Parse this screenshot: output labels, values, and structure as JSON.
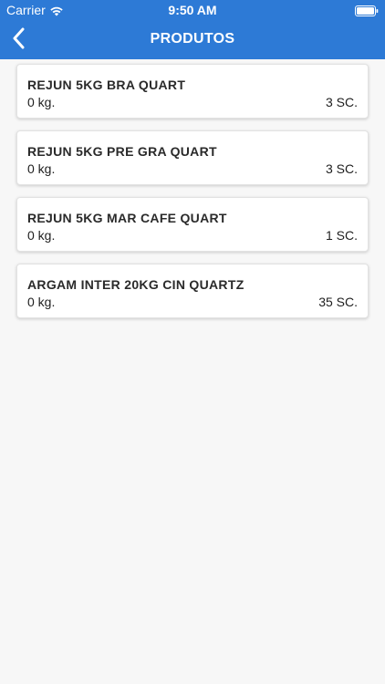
{
  "status_bar": {
    "carrier": "Carrier",
    "time": "9:50 AM",
    "wifi_icon": "wifi-icon",
    "battery_icon": "battery-icon"
  },
  "nav": {
    "title": "PRODUTOS",
    "back_icon": "chevron-left-icon"
  },
  "colors": {
    "header_bg": "#2d7ad6",
    "page_bg": "#f7f7f7",
    "card_bg": "#ffffff"
  },
  "products": [
    {
      "name": "REJUN 5KG BRA QUART",
      "weight": "0 kg.",
      "quantity": "3 SC."
    },
    {
      "name": "REJUN 5KG PRE GRA QUART",
      "weight": "0 kg.",
      "quantity": "3 SC."
    },
    {
      "name": "REJUN 5KG MAR CAFE QUART",
      "weight": "0 kg.",
      "quantity": "1 SC."
    },
    {
      "name": "ARGAM INTER 20KG CIN QUARTZ",
      "weight": "0 kg.",
      "quantity": "35 SC."
    }
  ]
}
